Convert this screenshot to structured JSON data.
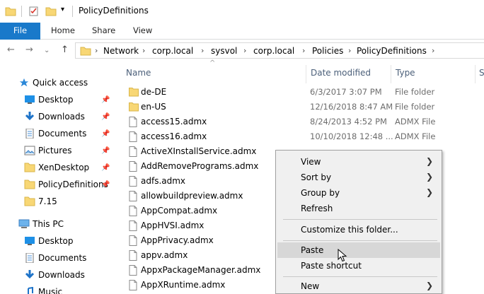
{
  "window": {
    "title": "PolicyDefinitions"
  },
  "ribbon": {
    "tabs": [
      "File",
      "Home",
      "Share",
      "View"
    ]
  },
  "address": {
    "crumbs": [
      "Network",
      "corp.local",
      "sysvol",
      "corp.local",
      "Policies",
      "PolicyDefinitions"
    ]
  },
  "nav": {
    "quick_access": "Quick access",
    "items": [
      {
        "label": "Desktop",
        "icon": "desktop-icon",
        "pinned": true
      },
      {
        "label": "Downloads",
        "icon": "downloads-icon",
        "pinned": true
      },
      {
        "label": "Documents",
        "icon": "documents-icon",
        "pinned": true
      },
      {
        "label": "Pictures",
        "icon": "pictures-icon",
        "pinned": true
      },
      {
        "label": "XenDesktop",
        "icon": "folder-icon",
        "pinned": true
      },
      {
        "label": "PolicyDefinitions",
        "icon": "folder-icon",
        "pinned": true
      },
      {
        "label": "7.15",
        "icon": "folder-icon",
        "pinned": false
      }
    ],
    "this_pc": "This PC",
    "pc_items": [
      {
        "label": "Desktop",
        "icon": "desktop-icon"
      },
      {
        "label": "Documents",
        "icon": "documents-icon"
      },
      {
        "label": "Downloads",
        "icon": "downloads-icon"
      },
      {
        "label": "Music",
        "icon": "music-icon"
      }
    ]
  },
  "columns": {
    "name": "Name",
    "date": "Date modified",
    "type": "Type",
    "size": "S"
  },
  "files": [
    {
      "name": "de-DE",
      "date": "6/3/2017 3:07 PM",
      "type": "File folder",
      "icon": "folder-icon"
    },
    {
      "name": "en-US",
      "date": "12/16/2018 8:47 AM",
      "type": "File folder",
      "icon": "folder-icon"
    },
    {
      "name": "access15.admx",
      "date": "8/24/2013 4:52 PM",
      "type": "ADMX File",
      "icon": "file-icon"
    },
    {
      "name": "access16.admx",
      "date": "10/10/2018 12:48 ...",
      "type": "ADMX File",
      "icon": "file-icon"
    },
    {
      "name": "ActiveXInstallService.admx",
      "date": "",
      "type": "",
      "icon": "file-icon"
    },
    {
      "name": "AddRemovePrograms.admx",
      "date": "",
      "type": "",
      "icon": "file-icon"
    },
    {
      "name": "adfs.admx",
      "date": "",
      "type": "",
      "icon": "file-icon"
    },
    {
      "name": "allowbuildpreview.admx",
      "date": "",
      "type": "",
      "icon": "file-icon"
    },
    {
      "name": "AppCompat.admx",
      "date": "",
      "type": "",
      "icon": "file-icon"
    },
    {
      "name": "AppHVSI.admx",
      "date": "",
      "type": "",
      "icon": "file-icon"
    },
    {
      "name": "AppPrivacy.admx",
      "date": "",
      "type": "",
      "icon": "file-icon"
    },
    {
      "name": "appv.admx",
      "date": "",
      "type": "",
      "icon": "file-icon"
    },
    {
      "name": "AppxPackageManager.admx",
      "date": "",
      "type": "",
      "icon": "file-icon"
    },
    {
      "name": "AppXRuntime.admx",
      "date": "",
      "type": "",
      "icon": "file-icon"
    }
  ],
  "context_menu": {
    "view": "View",
    "sort_by": "Sort by",
    "group_by": "Group by",
    "refresh": "Refresh",
    "customize": "Customize this folder...",
    "paste": "Paste",
    "paste_shortcut": "Paste shortcut",
    "new": "New"
  },
  "colors": {
    "accent": "#1979ca",
    "folder": "#f8d775",
    "menu_bg": "#f0f0f0",
    "menu_highlight": "#d7d7d7"
  }
}
